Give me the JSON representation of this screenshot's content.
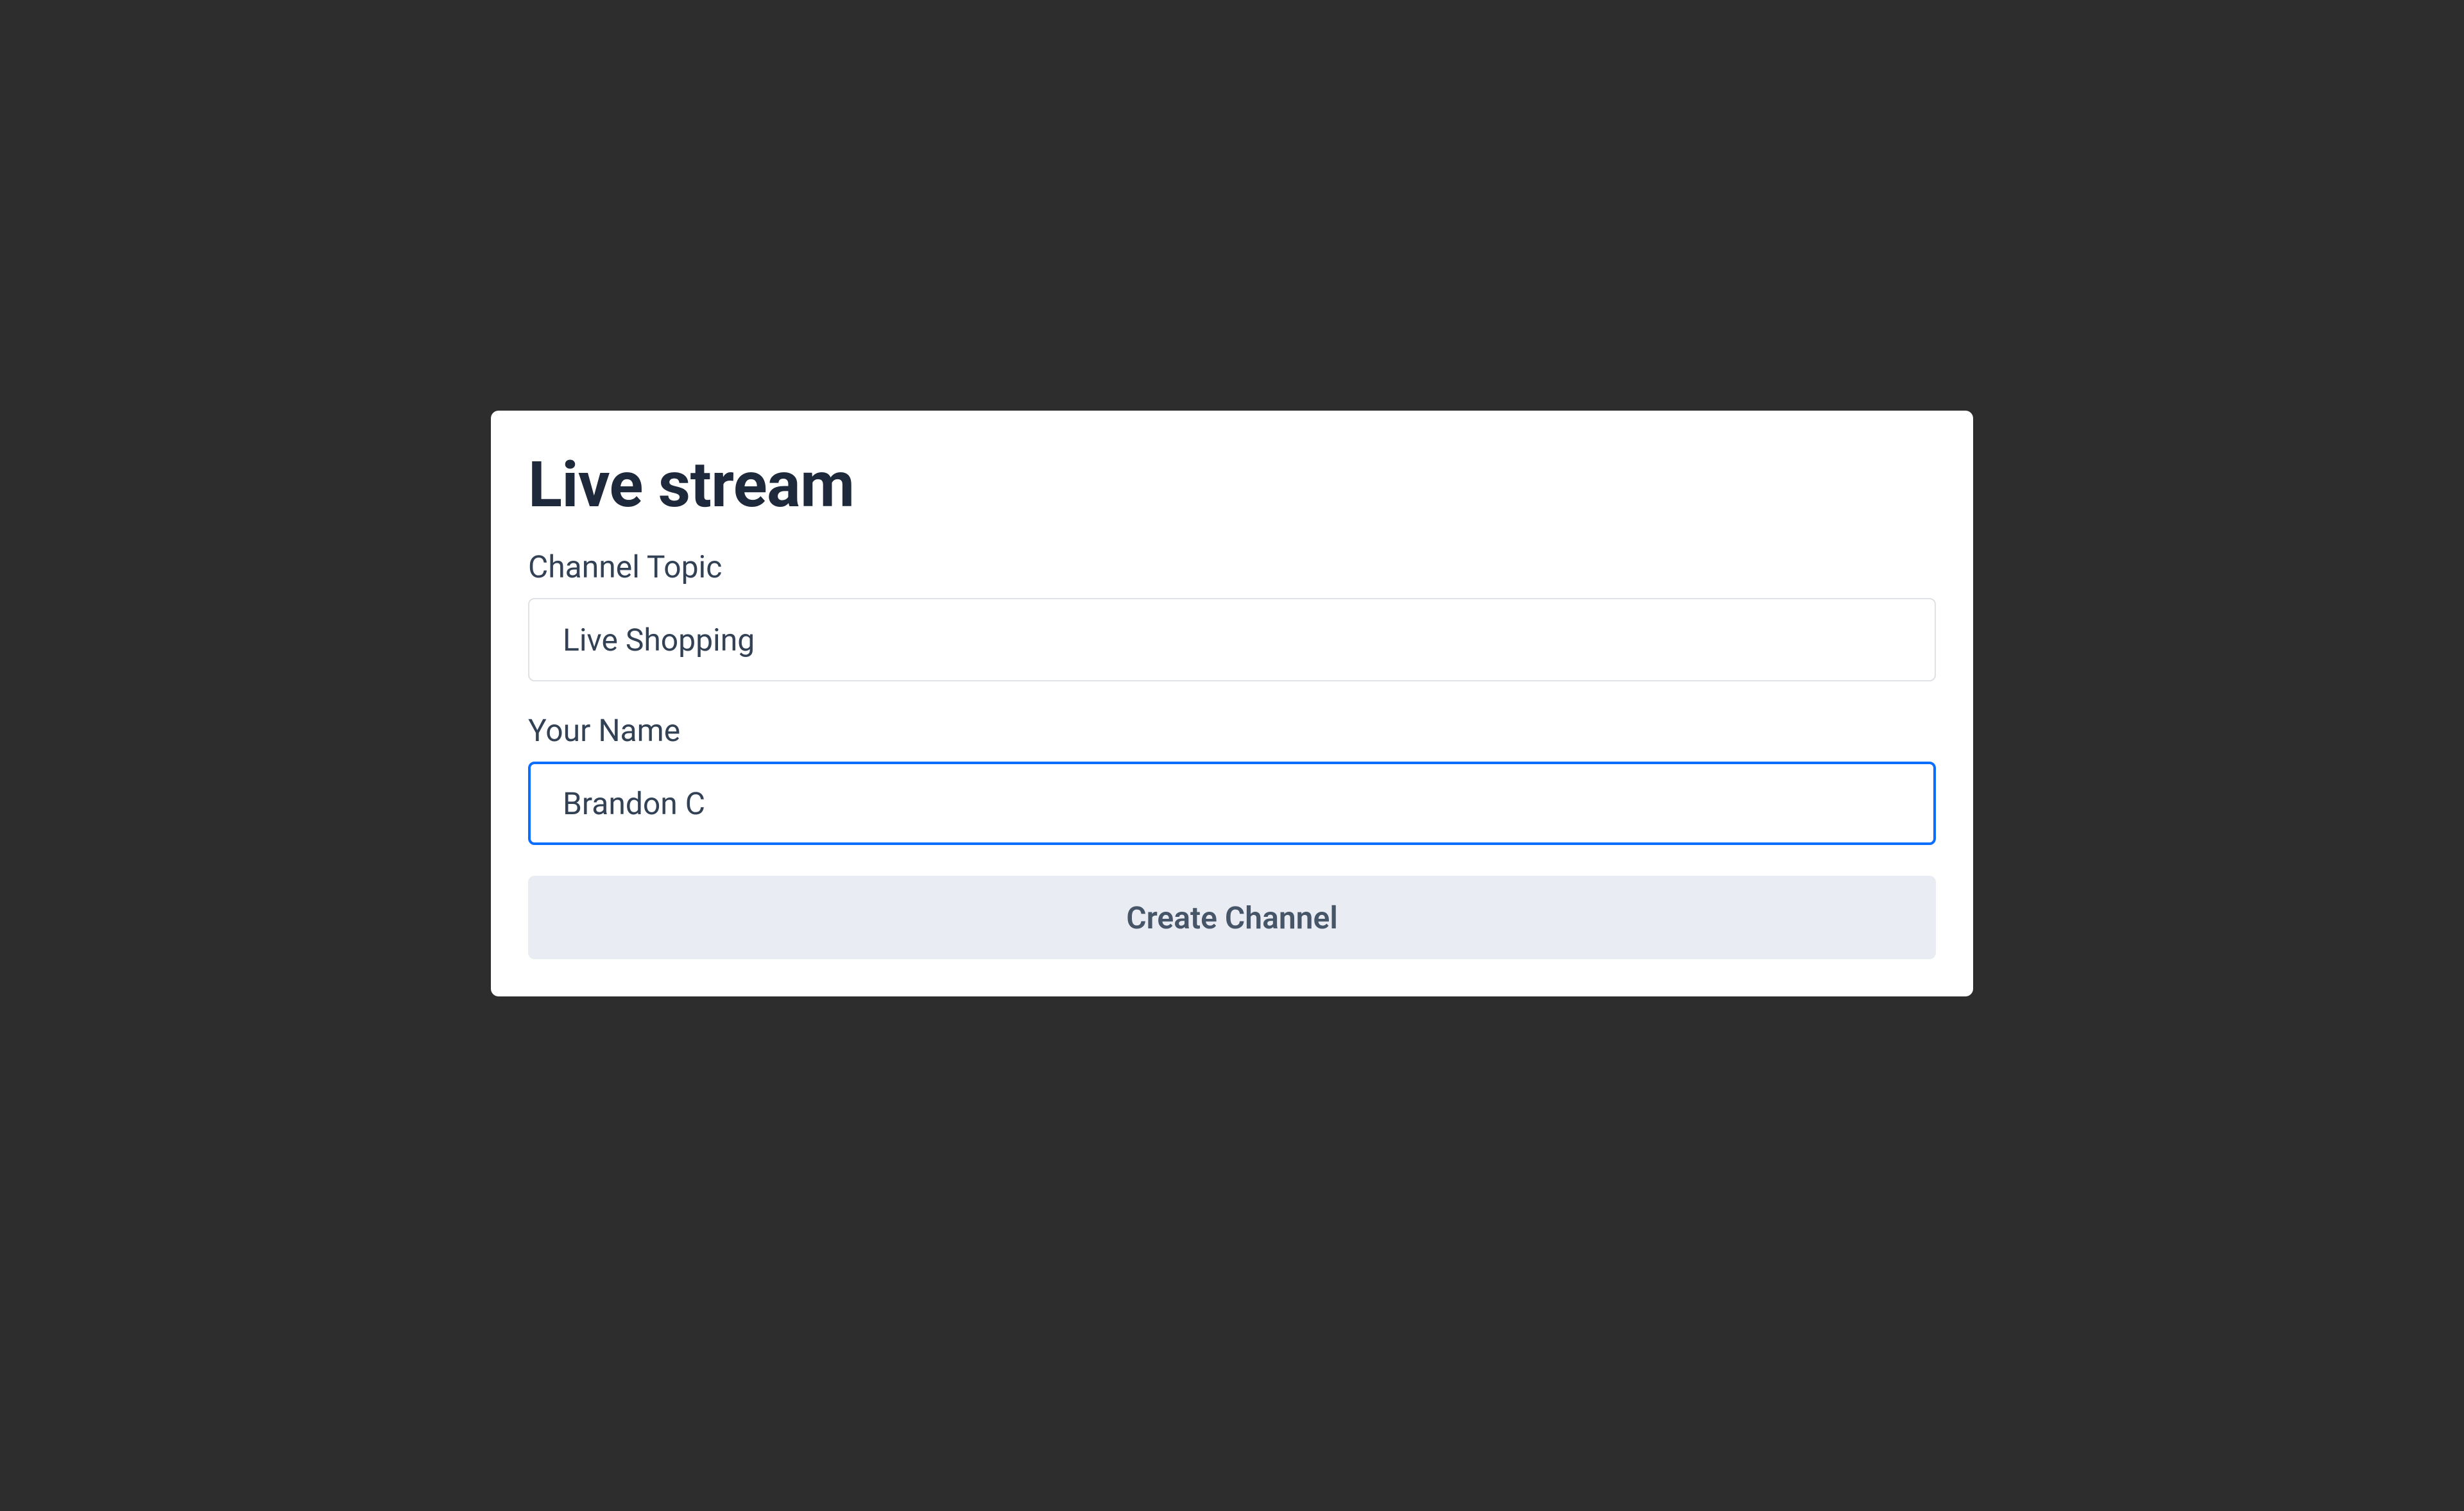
{
  "form": {
    "title": "Live stream",
    "channel_topic": {
      "label": "Channel Topic",
      "value": "Live Shopping"
    },
    "your_name": {
      "label": "Your Name",
      "value": "Brandon C"
    },
    "submit_label": "Create Channel"
  }
}
